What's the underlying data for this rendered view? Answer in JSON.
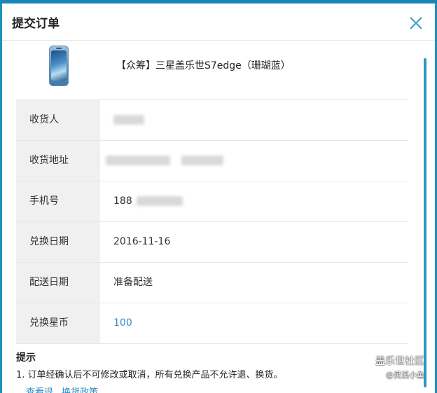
{
  "header": {
    "title": "提交订单"
  },
  "product": {
    "name": "【众筹】三星盖乐世S7edge（珊瑚蓝）"
  },
  "rows": [
    {
      "label": "收货人",
      "value": "",
      "redacted": true
    },
    {
      "label": "收货地址",
      "value": "",
      "redacted": true
    },
    {
      "label": "手机号",
      "value": "188",
      "redacted": true
    },
    {
      "label": "兑换日期",
      "value": "2016-11-16"
    },
    {
      "label": "配送日期",
      "value": "准备配送"
    },
    {
      "label": "兑换星币",
      "value": "100"
    }
  ],
  "tips": {
    "title": "提示",
    "line1": "1. 订单经确认后不可修改或取消，所有兑换产品不允许退、换货。",
    "link1": "查看退",
    "link2": "换货政策"
  },
  "watermark": {
    "line1": "盖乐世社区",
    "line2": "@灵溪小鱼"
  },
  "colors": {
    "accent": "#2b8fc6",
    "backdrop": "#1f8fc0",
    "label_bg": "#f0f0f0"
  }
}
